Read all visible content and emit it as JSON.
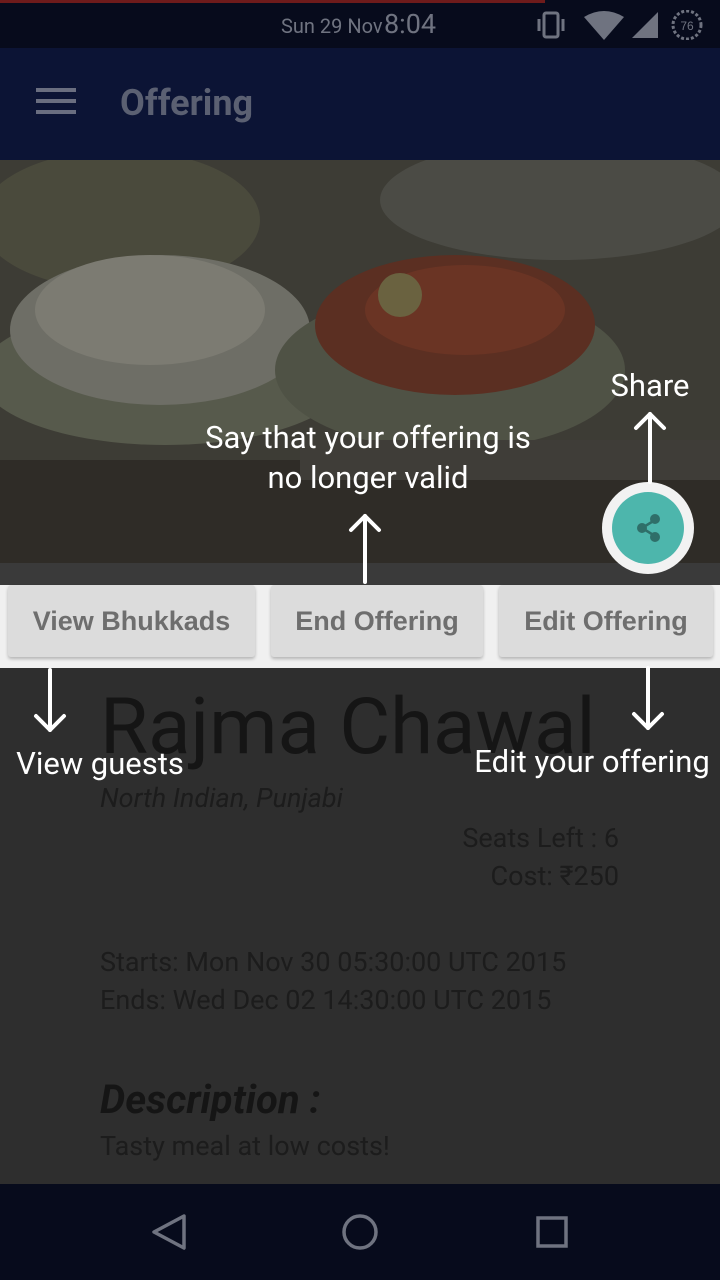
{
  "status_bar": {
    "date": "Sun 29 Nov",
    "time": "8:04",
    "battery_level": "76",
    "icons": [
      "vibrate-icon",
      "wifi-icon",
      "signal-icon",
      "battery-icon"
    ]
  },
  "app_bar": {
    "title": "Offering",
    "menu_icon": "hamburger-menu-icon"
  },
  "actions": {
    "view_label": "View Bhukkads",
    "end_label": "End Offering",
    "edit_label": "Edit Offering",
    "share_icon": "share-icon"
  },
  "offering": {
    "name": "Rajma Chawal",
    "cuisine": "North Indian,  Punjabi",
    "seats_left": "Seats Left : 6",
    "cost": "Cost: ₹250",
    "starts": "Starts: Mon Nov 30 05:30:00 UTC 2015",
    "ends": "Ends: Wed Dec 02 14:30:00 UTC 2015",
    "description_title": "Description :",
    "description": "Tasty meal at low costs!"
  },
  "tutorial": {
    "share": "Share",
    "end": "Say that your offering is no longer valid",
    "view": "View guests",
    "edit": "Edit your offering"
  },
  "nav_bar": {
    "icons": [
      "back-icon",
      "home-icon",
      "recents-icon"
    ]
  },
  "colors": {
    "fab": "#4db6ac",
    "app_bar": "#0c1435",
    "overlay_text": "#ffffff"
  }
}
